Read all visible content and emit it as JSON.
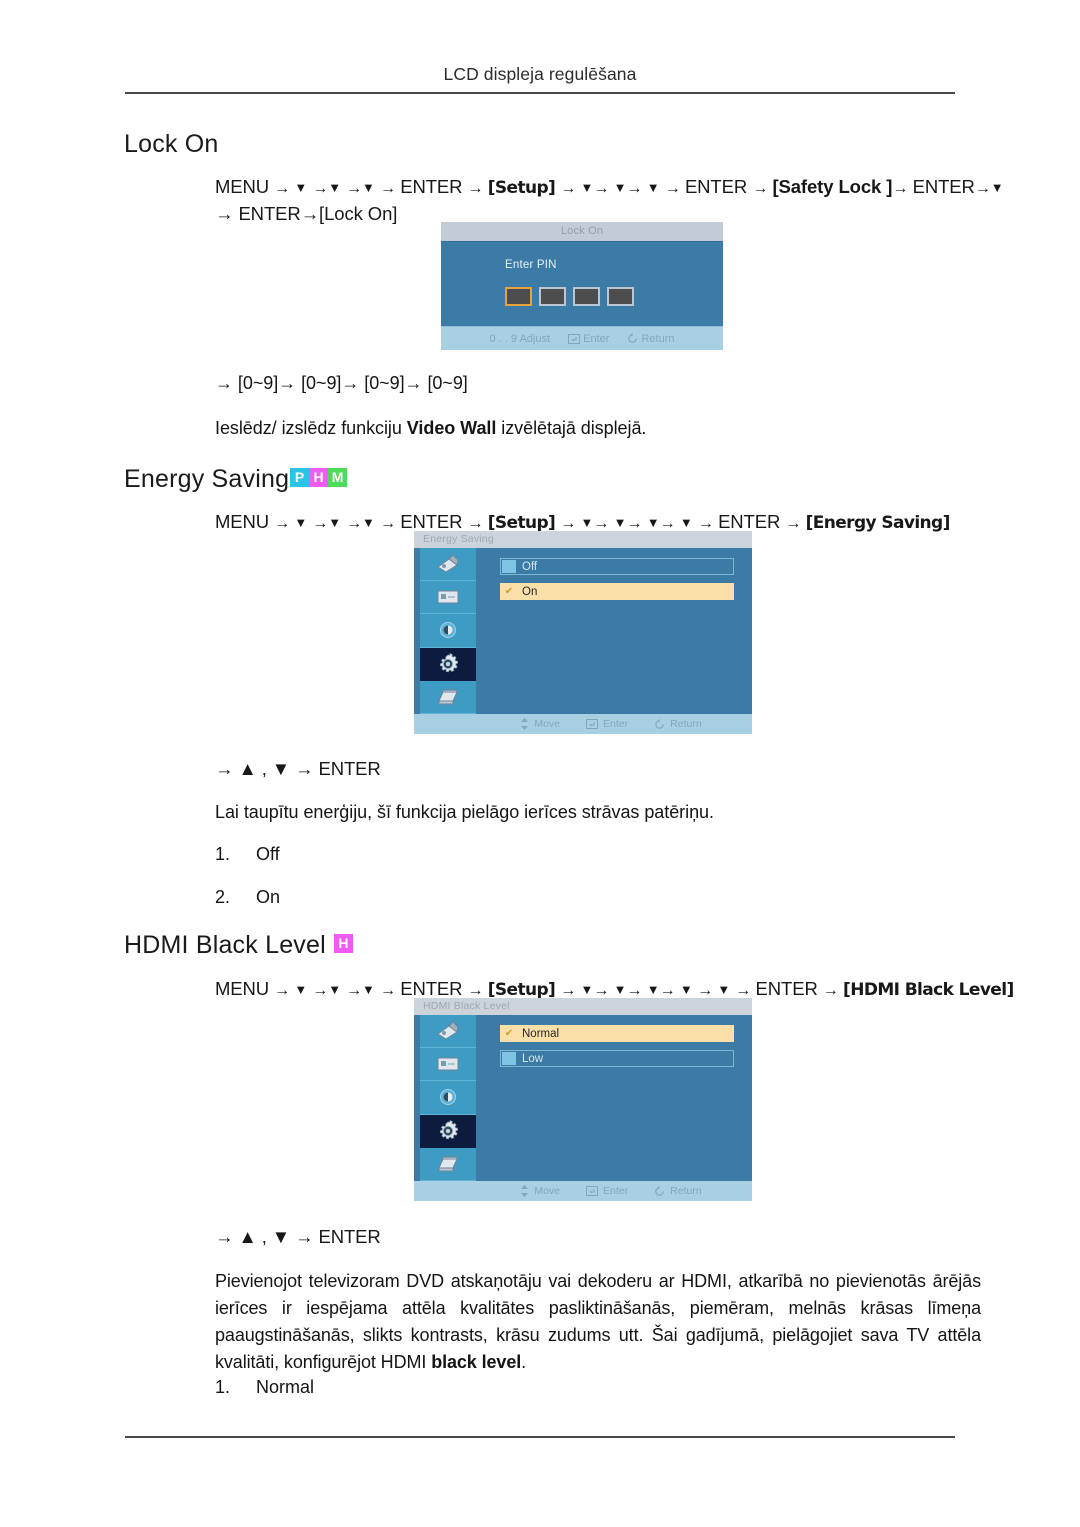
{
  "header": {
    "running_head": "LCD displeja regulēšana"
  },
  "sections": [
    {
      "id": "lock-on",
      "title": "Lock On",
      "badges": [],
      "path_line1": {
        "menu": "MENU",
        "enter1": "ENTER",
        "setup": "[Setup]",
        "enter2": "ENTER",
        "safety_lock": "[Safety Lock ]",
        "enter3": "ENTER"
      },
      "path_line2": "→ ENTER→[Lock On]",
      "pin_line": "→ [0~9]→ [0~9]→ [0~9]→ [0~9]",
      "description_pre": "Ieslēdz/ izslēdz funkciju ",
      "description_bold": "Video Wall",
      "description_post": " izvēlētajā displejā."
    },
    {
      "id": "energy-saving",
      "title": "Energy Saving",
      "badges": [
        "P",
        "H",
        "M"
      ],
      "path": {
        "menu": "MENU",
        "enter1": "ENTER",
        "setup": "[Setup]",
        "enter2": "ENTER",
        "target": "[Energy Saving]"
      },
      "nav_line": "→ ▲ , ▼ → ENTER",
      "description": "Lai taupītu enerģiju, šī funkcija pielāgo ierīces strāvas patēriņu.",
      "options": [
        {
          "num": "1.",
          "label": "Off"
        },
        {
          "num": "2.",
          "label": "On"
        }
      ]
    },
    {
      "id": "hdmi-black-level",
      "title": "HDMI Black Level",
      "badges": [
        "H"
      ],
      "path": {
        "menu": "MENU",
        "enter1": "ENTER",
        "setup": "[Setup]",
        "enter2": "ENTER",
        "target": "[HDMI Black Level]"
      },
      "nav_line": "→ ▲ , ▼ → ENTER",
      "description": "Pievienojot televizoram DVD atskaņotāju vai dekoderu ar HDMI, atkarībā no pievienotās ārējās ierīces ir iespējama attēla kvalitātes pasliktināšanās, piemēram, melnās krāsas līmeņa paaugstināšanās, slikts kontrasts, krāsu zudums utt. Šai gadījumā, pielāgojiet sava TV attēla kvalitāti, konfigurējot HDMI ",
      "description_bold": "black level",
      "description_post": ".",
      "options": [
        {
          "num": "1.",
          "label": "Normal"
        }
      ]
    }
  ],
  "osd_lock": {
    "title": "Lock On",
    "prompt": "Enter PIN",
    "pin_digits": [
      "",
      "",
      "",
      ""
    ],
    "footer": {
      "adjust": "0 . . 9 Adjust",
      "enter": "Enter",
      "return": "Return"
    }
  },
  "osd_energy": {
    "title": "Energy Saving",
    "sidebar_icons": [
      "picture-icon",
      "screen-icon",
      "sound-icon",
      "setup-gear-icon",
      "multi-control-icon"
    ],
    "selected_sidebar_index": 3,
    "options": [
      {
        "label": "Off",
        "selected": false
      },
      {
        "label": "On",
        "selected": true
      }
    ],
    "footer": {
      "move": "Move",
      "enter": "Enter",
      "return": "Return"
    }
  },
  "osd_hdmi": {
    "title": "HDMI Black Level",
    "sidebar_icons": [
      "picture-icon",
      "screen-icon",
      "sound-icon",
      "setup-gear-icon",
      "multi-control-icon"
    ],
    "selected_sidebar_index": 3,
    "options": [
      {
        "label": "Normal",
        "selected": true
      },
      {
        "label": "Low",
        "selected": false
      }
    ],
    "footer": {
      "move": "Move",
      "enter": "Enter",
      "return": "Return"
    }
  },
  "colors": {
    "osd_blue": "#3b7ba5",
    "osd_sidebar": "#3e9bc4",
    "osd_selected_row": "#fadfa8",
    "osd_footer": "#a8d0e2",
    "badge_p": "#29c4e6",
    "badge_h": "#ee5cf2",
    "badge_m": "#4ddb5a",
    "pin_active_border": "#e8a33d"
  }
}
